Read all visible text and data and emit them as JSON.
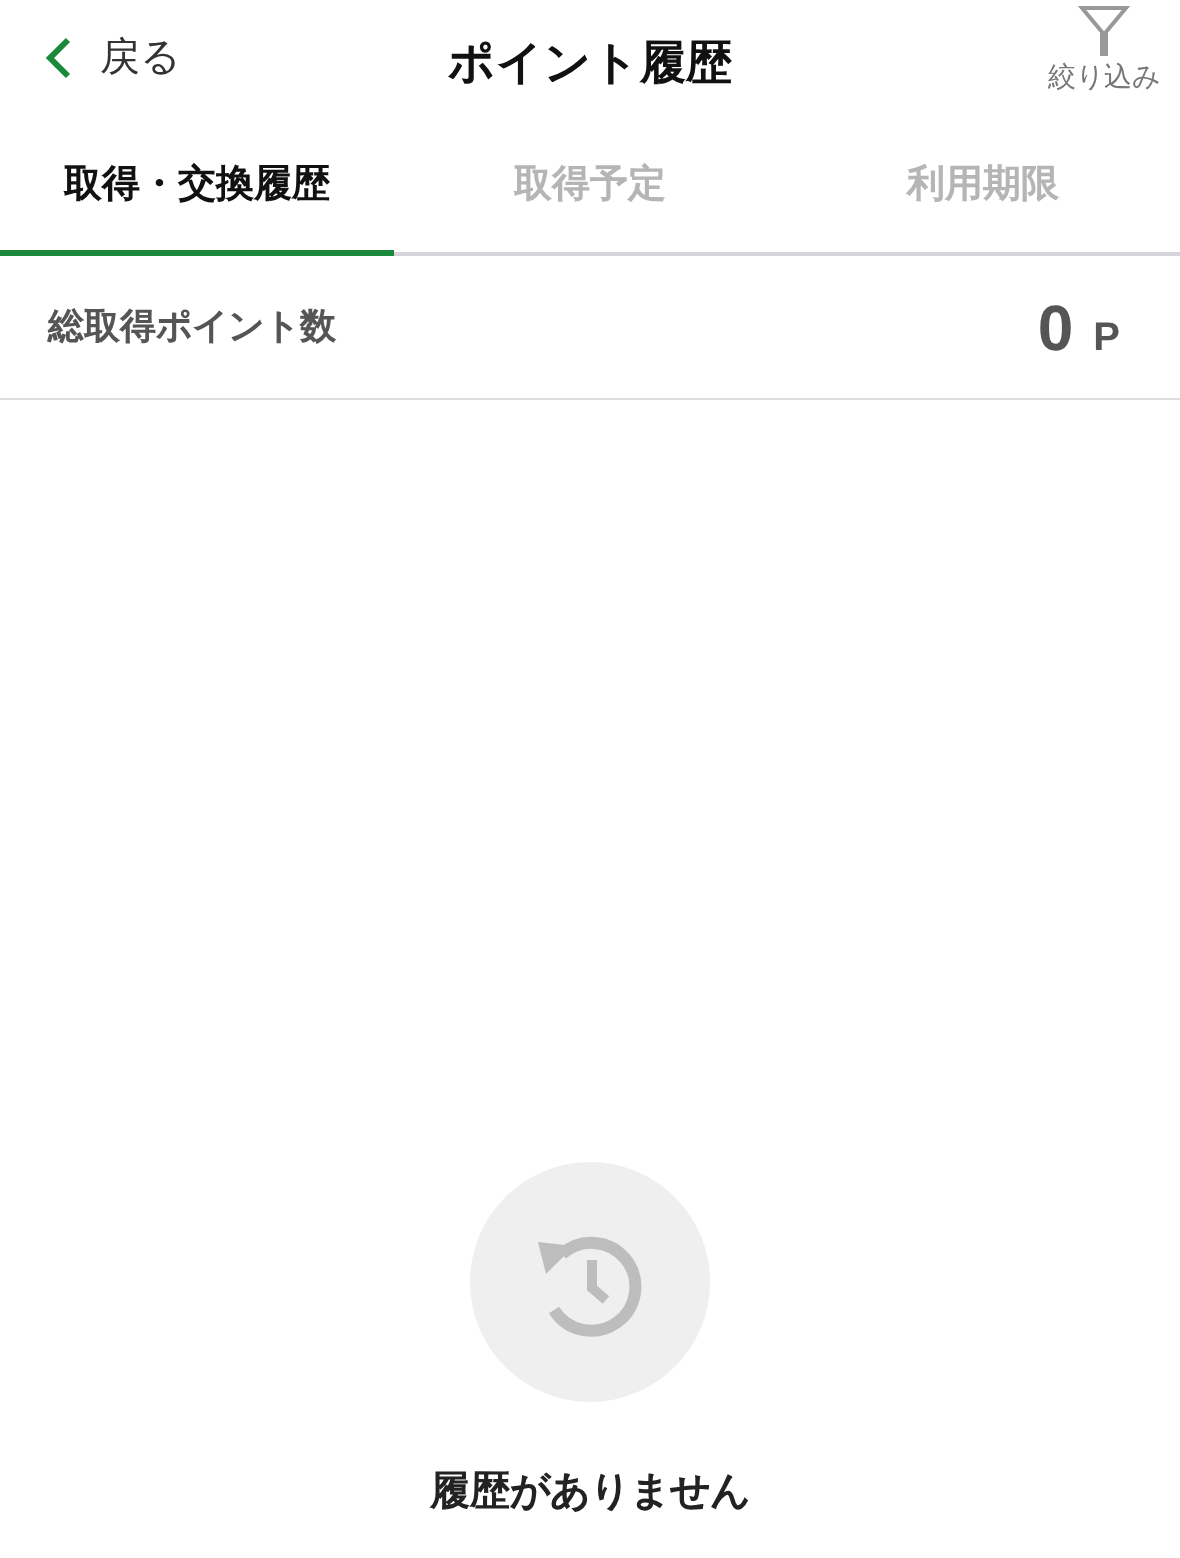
{
  "header": {
    "back_label": "戻る",
    "title": "ポイント履歴",
    "filter_label": "絞り込み"
  },
  "tabs": [
    {
      "label": "取得・交換履歴",
      "selected": true
    },
    {
      "label": "取得予定",
      "selected": false
    },
    {
      "label": "利用期限",
      "selected": false
    }
  ],
  "summary": {
    "label": "総取得ポイント数",
    "value": "0",
    "unit": "P"
  },
  "empty_state": {
    "message": "履歴がありません"
  }
}
